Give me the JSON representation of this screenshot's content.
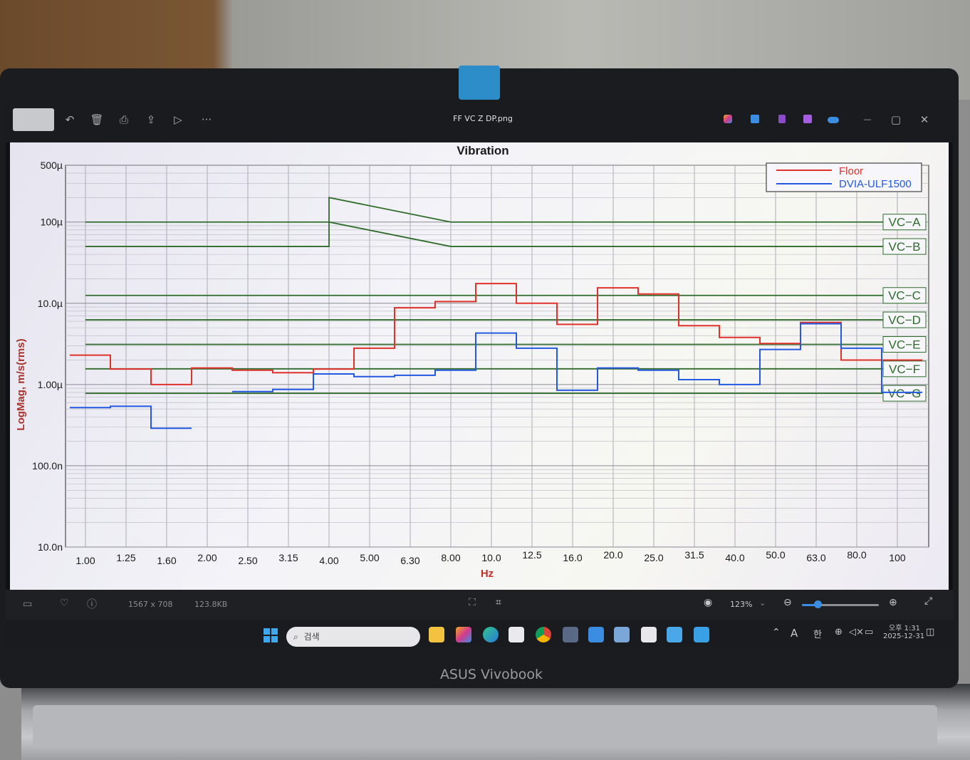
{
  "window": {
    "title": "FF VC Z DP.png",
    "toolbar_icons": [
      "undo-icon",
      "delete-icon",
      "print-icon",
      "share-icon",
      "slideshow-icon",
      "more-icon"
    ],
    "title_icons": [
      "copilot-icon",
      "edit-icon",
      "app-icon",
      "clipchamp-icon",
      "onedrive-icon"
    ],
    "controls": [
      "minimize-icon",
      "maximize-icon",
      "close-icon"
    ],
    "more_label": "···",
    "min_label": "—",
    "max_label": "▢",
    "close_label": "✕"
  },
  "status": {
    "dimensions": "1567 x 708",
    "file_size": "123.8KB",
    "zoom": "123%",
    "zoom_fraction": 0.2
  },
  "taskbar": {
    "search_placeholder": "검색",
    "ime_a": "A",
    "ime_lang": "한",
    "time": "오후 1:31",
    "date": "2025-12-31"
  },
  "laptop": {
    "brand": "ASUS Vivobook"
  },
  "colors": {
    "floor": "#e0322a",
    "dvia": "#2358e0",
    "vc": "#2f6b2a",
    "accent": "#3b8de1"
  },
  "chart_data": {
    "type": "line",
    "title": "Vibration",
    "xlabel": "Hz",
    "ylabel": "LogMag, m/s(rms)",
    "yscale": "log",
    "ylim": [
      1e-08,
      0.0005
    ],
    "grid": true,
    "legend": "top-right",
    "x_ticks": [
      "1.00",
      "1.25",
      "1.60",
      "2.00",
      "2.50",
      "3.15",
      "4.00",
      "5.00",
      "6.30",
      "8.00",
      "10.0",
      "12.5",
      "16.0",
      "20.0",
      "25.0",
      "31.5",
      "40.0",
      "50.0",
      "63.0",
      "80.0",
      "100"
    ],
    "y_ticks": [
      {
        "value": 1e-08,
        "label": "10.0n"
      },
      {
        "value": 1e-07,
        "label": "100.0n"
      },
      {
        "value": 1e-06,
        "label": "1.00µ"
      },
      {
        "value": 1e-05,
        "label": "10.0µ"
      },
      {
        "value": 0.0001,
        "label": "100µ"
      },
      {
        "value": 0.0005,
        "label": "500µ"
      }
    ],
    "band_index": [
      0,
      1,
      2,
      3,
      4,
      5,
      6,
      7,
      8,
      9,
      10,
      11,
      12,
      13,
      14,
      15,
      16,
      17,
      18,
      19,
      20
    ],
    "series": [
      {
        "name": "Floor",
        "values": [
          2.3e-06,
          1.55e-06,
          1e-06,
          1.6e-06,
          1.5e-06,
          1.4e-06,
          1.55e-06,
          2.8e-06,
          8.8e-06,
          1.05e-05,
          1.75e-05,
          1e-05,
          5.5e-06,
          1.55e-05,
          1.3e-05,
          5.3e-06,
          3.8e-06,
          3.2e-06,
          5.8e-06,
          2e-06,
          2e-06
        ]
      },
      {
        "name": "DVIA-ULF1500",
        "values": [
          5.2e-07,
          5.4e-07,
          2.9e-07,
          0.0,
          8.2e-07,
          8.7e-07,
          1.35e-06,
          1.25e-06,
          1.3e-06,
          1.5e-06,
          4.3e-06,
          2.8e-06,
          8.5e-07,
          1.6e-06,
          1.5e-06,
          1.15e-06,
          1e-06,
          2.7e-06,
          5.6e-06,
          2.8e-06,
          8e-07
        ]
      }
    ],
    "criteria": [
      {
        "label": "VC−A",
        "low": 5e-05,
        "high": 0.0001
      },
      {
        "label": "VC−B",
        "low": 2.5e-05,
        "high": 5e-05
      },
      {
        "label": "VC−C",
        "low": 1.25e-05,
        "high": 1.25e-05
      },
      {
        "label": "VC−D",
        "low": 6.25e-06,
        "high": 6.25e-06
      },
      {
        "label": "VC−E",
        "low": 3.12e-06,
        "high": 3.12e-06
      },
      {
        "label": "VC−F",
        "low": 1.56e-06,
        "high": 1.56e-06
      },
      {
        "label": "VC−G",
        "low": 7.8e-07,
        "high": 7.8e-07
      }
    ]
  }
}
